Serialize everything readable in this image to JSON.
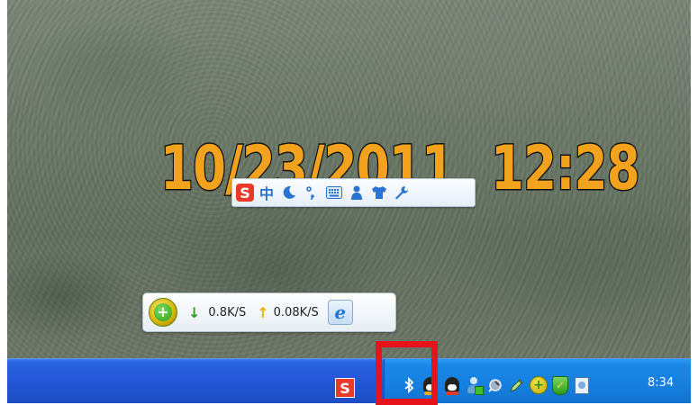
{
  "desktop": {
    "clock_date": "10/23/2011",
    "clock_time": "12:28"
  },
  "ime_toolbar": {
    "logo": "S",
    "mode_label": "中",
    "items": [
      "moon-icon",
      "punctuation-icon",
      "keyboard-icon",
      "user-icon",
      "shirt-icon",
      "wrench-icon"
    ]
  },
  "net_monitor": {
    "download_speed": "0.8K/S",
    "upload_speed": "0.08K/S"
  },
  "taskbar": {
    "app_button_label": "S",
    "tray_time": "8:34",
    "tray_icons": [
      "bluetooth-icon",
      "qq-icon",
      "qq-red-icon",
      "user-status-icon",
      "plug-icon",
      "pen-icon",
      "360-guard-icon",
      "360-shield-icon",
      "document-icon"
    ]
  },
  "colors": {
    "highlight": "#e8131a",
    "taskbar": "#2456d6",
    "tray": "#167fdf",
    "clock_text": "#f2a21d"
  }
}
